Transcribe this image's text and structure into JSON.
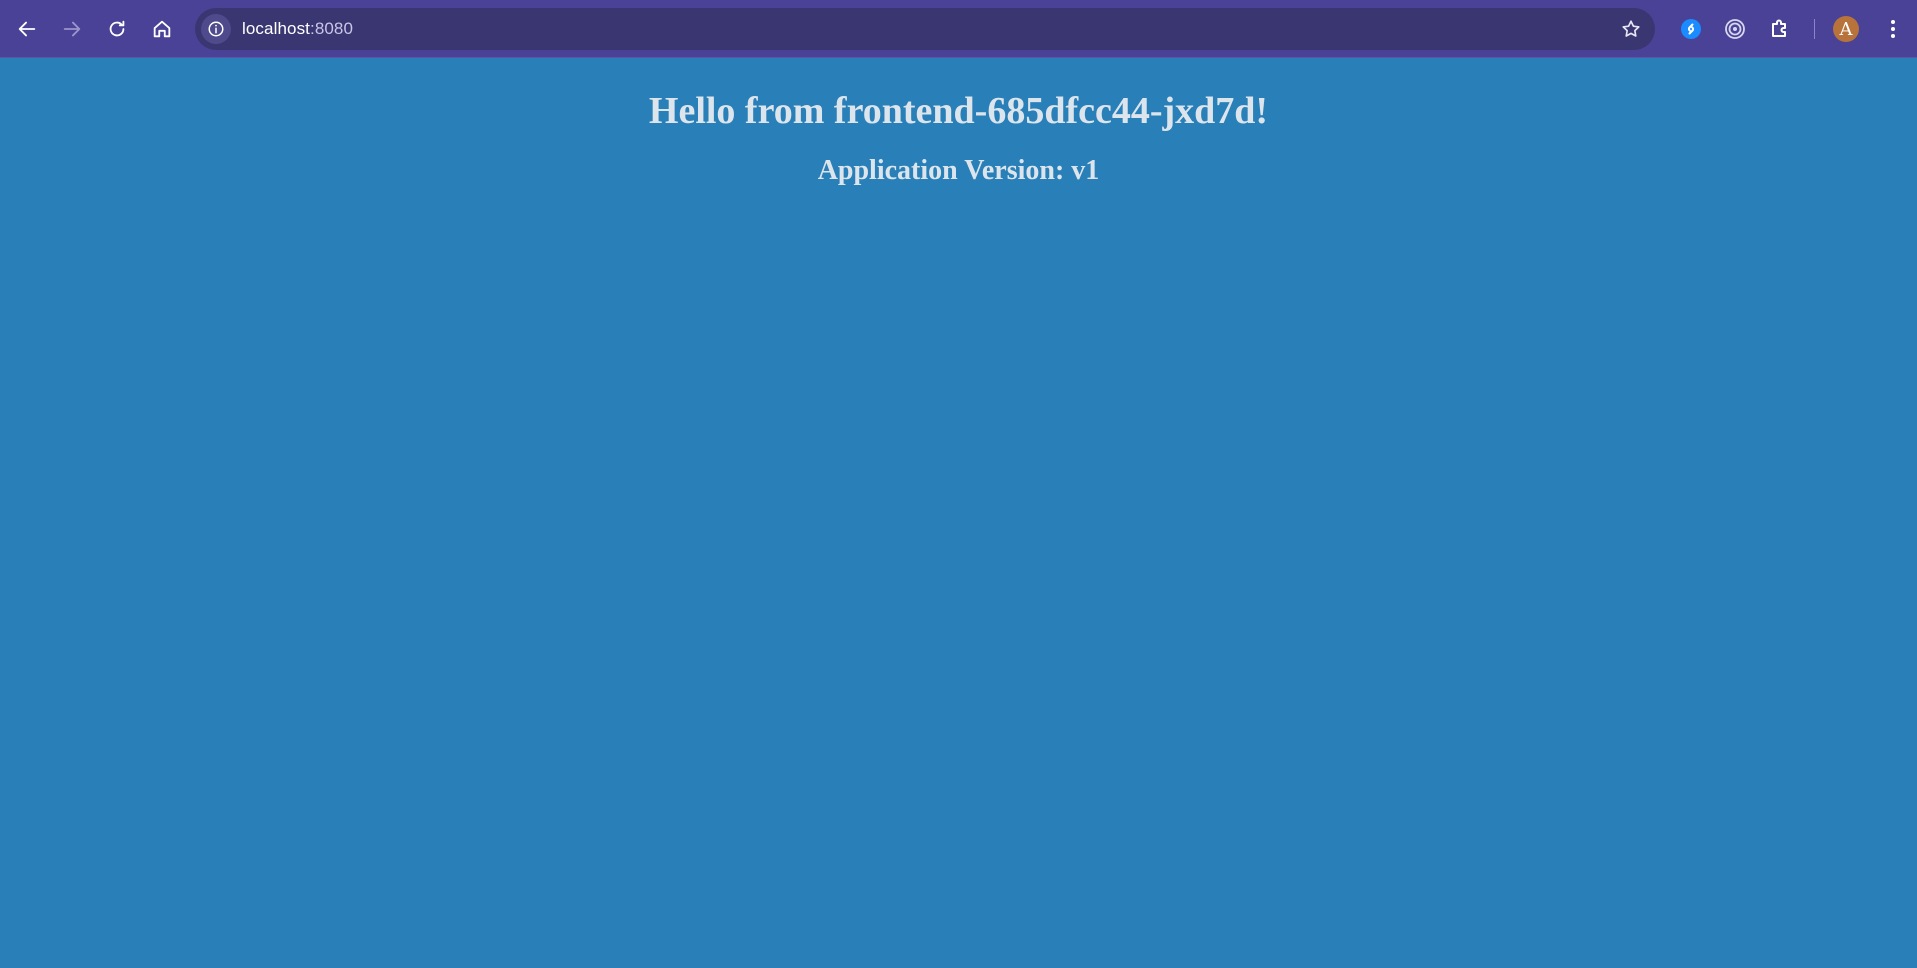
{
  "browser": {
    "url_host": "localhost",
    "url_port": ":8080",
    "avatar_letter": "A",
    "colors": {
      "toolbar": "#4a4296",
      "omnibox": "#3a3672",
      "page_background": "#2980b9",
      "page_text": "#dce4ec"
    },
    "icons": {
      "back": "arrow-left-icon",
      "forward": "arrow-right-icon",
      "reload": "reload-icon",
      "home": "home-icon",
      "site_info": "info-icon",
      "bookmark": "star-icon",
      "extension_1": "shazam-icon",
      "extension_2": "target-icon",
      "extensions": "puzzle-icon",
      "menu": "kebab-menu-icon"
    }
  },
  "page": {
    "heading": "Hello from frontend-685dfcc44-jxd7d!",
    "subheading": "Application Version: v1"
  }
}
